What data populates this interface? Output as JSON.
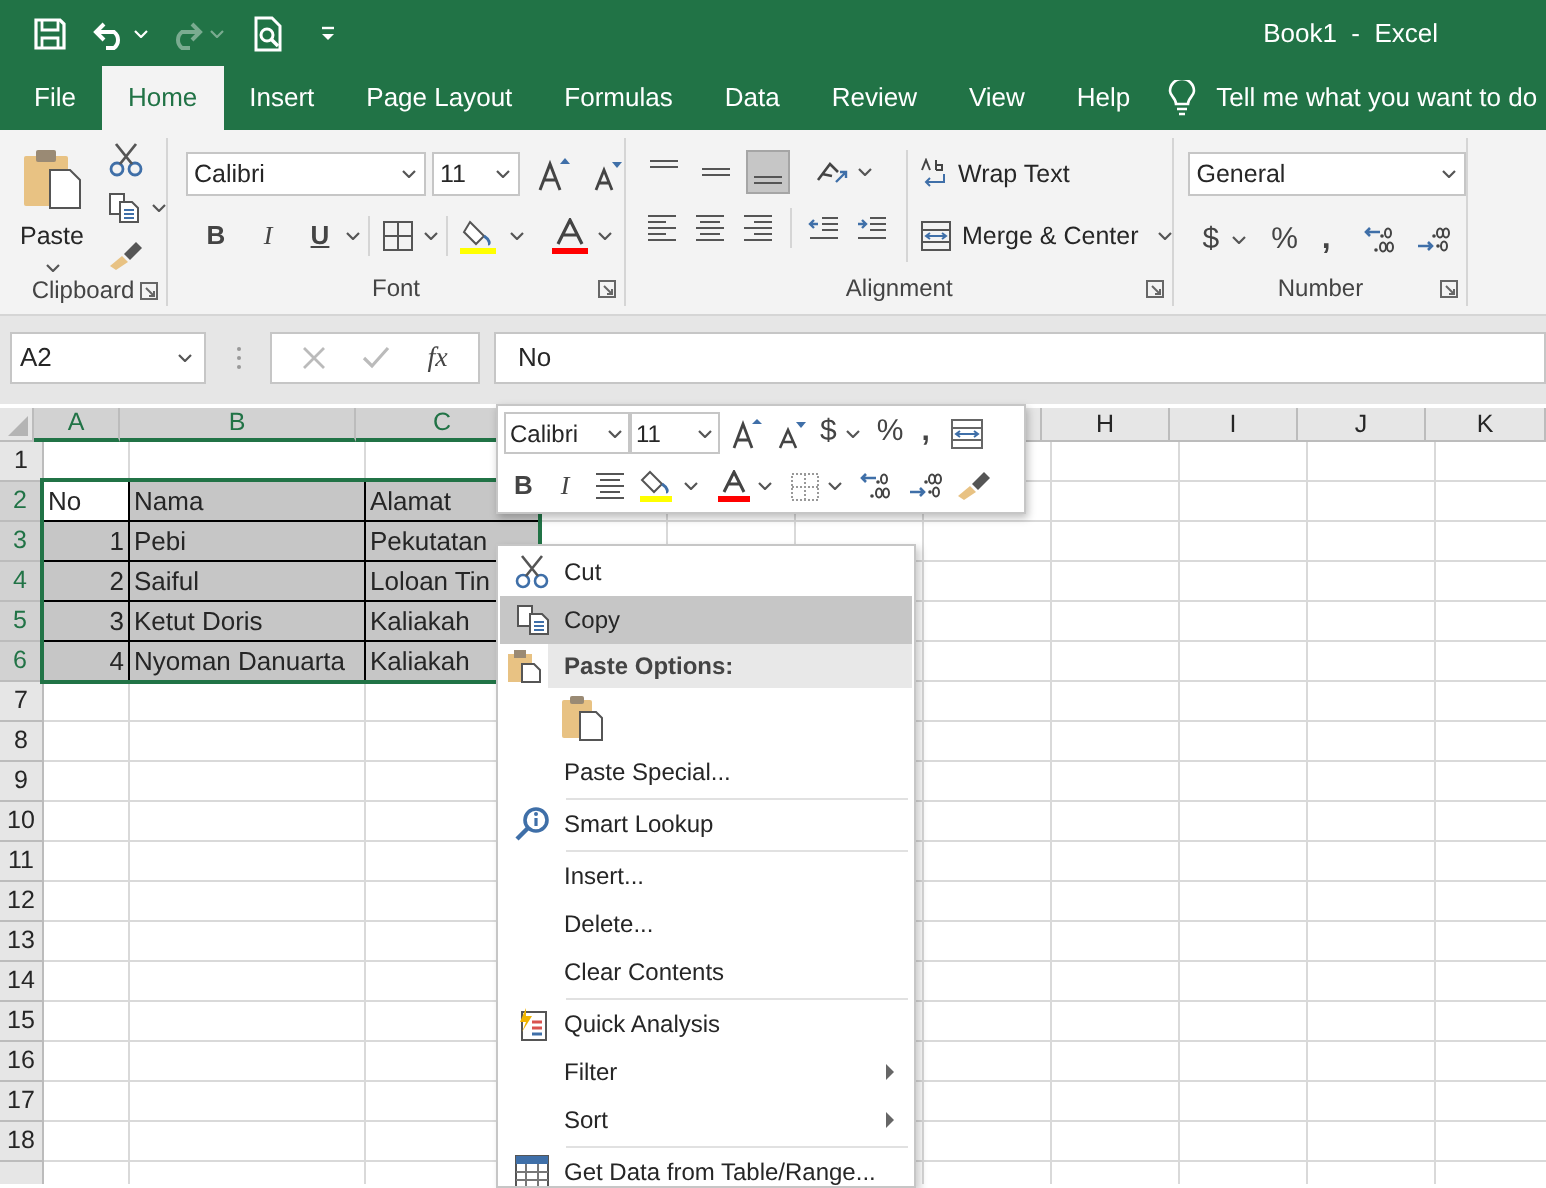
{
  "window": {
    "title": "Book1  -  Excel"
  },
  "tabs": [
    {
      "label": "File",
      "selected": false
    },
    {
      "label": "Home",
      "selected": true
    },
    {
      "label": "Insert",
      "selected": false
    },
    {
      "label": "Page Layout",
      "selected": false
    },
    {
      "label": "Formulas",
      "selected": false
    },
    {
      "label": "Data",
      "selected": false
    },
    {
      "label": "Review",
      "selected": false
    },
    {
      "label": "View",
      "selected": false
    },
    {
      "label": "Help",
      "selected": false
    }
  ],
  "tell_me": {
    "label": "Tell me what you want to do"
  },
  "ribbon": {
    "clipboard": {
      "paste": "Paste",
      "label": "Clipboard"
    },
    "font": {
      "font": "Calibri",
      "size": "11",
      "bold": "B",
      "italic": "I",
      "underline": "U",
      "label": "Font"
    },
    "alignment": {
      "vertical_align": [
        {
          "selected": false
        },
        {
          "selected": false
        },
        {
          "selected": true
        }
      ],
      "wrap_text": "Wrap Text",
      "merge": "Merge & Center",
      "label": "Alignment"
    },
    "number": {
      "format": "General",
      "currency": "$",
      "percent": "%",
      "comma": ",",
      "label": "Number"
    }
  },
  "formula_bar": {
    "name_box": "A2",
    "function_label": "fx",
    "value": "No"
  },
  "sheet": {
    "columns": [
      {
        "label": "A",
        "selected": true
      },
      {
        "label": "B",
        "selected": true
      },
      {
        "label": "C",
        "selected": true
      },
      {
        "label": "H",
        "selected": false
      },
      {
        "label": "I",
        "selected": false
      },
      {
        "label": "J",
        "selected": false
      },
      {
        "label": "K",
        "selected": false
      }
    ],
    "rows": [
      {
        "header": "1",
        "selected": false
      },
      {
        "header": "2",
        "selected": true,
        "cells": [
          {
            "text": "No",
            "kind": "text",
            "selected": true,
            "active": true
          },
          {
            "text": "Nama",
            "kind": "text",
            "selected": true,
            "active": false
          },
          {
            "text": "Alamat",
            "kind": "text",
            "selected": true,
            "active": false
          }
        ]
      },
      {
        "header": "3",
        "selected": true,
        "cells": [
          {
            "text": "1",
            "kind": "number",
            "selected": true,
            "active": false
          },
          {
            "text": "Pebi",
            "kind": "text",
            "selected": true,
            "active": false
          },
          {
            "text": "Pekutatan",
            "kind": "text",
            "selected": true,
            "active": false
          }
        ]
      },
      {
        "header": "4",
        "selected": true,
        "cells": [
          {
            "text": "2",
            "kind": "number",
            "selected": true,
            "active": false
          },
          {
            "text": "Saiful",
            "kind": "text",
            "selected": true,
            "active": false
          },
          {
            "text": "Loloan Tin",
            "kind": "text",
            "selected": true,
            "active": false
          }
        ]
      },
      {
        "header": "5",
        "selected": true,
        "cells": [
          {
            "text": "3",
            "kind": "number",
            "selected": true,
            "active": false
          },
          {
            "text": "Ketut Doris",
            "kind": "text",
            "selected": true,
            "active": false
          },
          {
            "text": "Kaliakah",
            "kind": "text",
            "selected": true,
            "active": false
          }
        ]
      },
      {
        "header": "6",
        "selected": true,
        "cells": [
          {
            "text": "4",
            "kind": "number",
            "selected": true,
            "active": false
          },
          {
            "text": "Nyoman Danuarta",
            "kind": "text",
            "selected": true,
            "active": false
          },
          {
            "text": "Kaliakah",
            "kind": "text",
            "selected": true,
            "active": false
          }
        ]
      },
      {
        "header": "7",
        "selected": false
      },
      {
        "header": "8",
        "selected": false
      },
      {
        "header": "9",
        "selected": false
      },
      {
        "header": "10",
        "selected": false
      },
      {
        "header": "11",
        "selected": false
      },
      {
        "header": "12",
        "selected": false
      },
      {
        "header": "13",
        "selected": false
      },
      {
        "header": "14",
        "selected": false
      },
      {
        "header": "15",
        "selected": false
      },
      {
        "header": "16",
        "selected": false
      },
      {
        "header": "17",
        "selected": false
      },
      {
        "header": "18",
        "selected": false
      }
    ]
  },
  "mini_toolbar": {
    "font": "Calibri",
    "size": "11",
    "currency": "$",
    "percent": "%",
    "comma": ",",
    "bold": "B",
    "italic": "I"
  },
  "context_menu": {
    "items": [
      {
        "kind": "item",
        "label": "Cut",
        "selected": false
      },
      {
        "kind": "item",
        "label": "Copy",
        "selected": true
      },
      {
        "kind": "header",
        "label": "Paste Options:"
      },
      {
        "kind": "paste_icons"
      },
      {
        "kind": "item",
        "label": "Paste Special...",
        "selected": false
      },
      {
        "kind": "separator"
      },
      {
        "kind": "item",
        "label": "Smart Lookup",
        "selected": false
      },
      {
        "kind": "separator"
      },
      {
        "kind": "item",
        "label": "Insert...",
        "selected": false
      },
      {
        "kind": "item",
        "label": "Delete...",
        "selected": false
      },
      {
        "kind": "item",
        "label": "Clear Contents",
        "selected": false
      },
      {
        "kind": "separator"
      },
      {
        "kind": "item",
        "label": "Quick Analysis",
        "selected": false
      },
      {
        "kind": "item",
        "label": "Filter",
        "selected": false,
        "submenu": true
      },
      {
        "kind": "item",
        "label": "Sort",
        "selected": false,
        "submenu": true
      },
      {
        "kind": "separator"
      },
      {
        "kind": "item",
        "label": "Get Data from Table/Range...",
        "selected": false
      }
    ]
  }
}
